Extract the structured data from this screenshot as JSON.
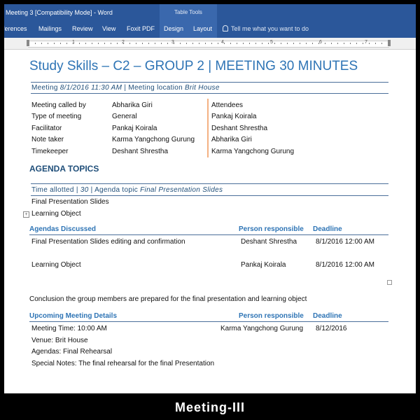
{
  "window": {
    "title": "Meeting 3 [Compatibility Mode] - Word",
    "context_tab_group": "Table Tools"
  },
  "ribbon": {
    "tabs": [
      "References",
      "Mailings",
      "Review",
      "View",
      "Foxit PDF",
      "Design",
      "Layout"
    ],
    "tabs_visible": [
      "ferences",
      "Mailings",
      "Review",
      "View",
      "Foxit PDF",
      "Design",
      "Layout"
    ],
    "tell_me": "Tell me what you want to do"
  },
  "ruler": {
    "numbers": [
      "1",
      "2",
      "3",
      "4",
      "5",
      "6",
      "7"
    ]
  },
  "doc": {
    "title": "Study Skills – C2 – GROUP 2  | MEETING 30 MINUTES",
    "meeting_line": {
      "prefix": "Meeting ",
      "date": "8/1/2016 11:30 AM",
      "sep": " | Meeting location ",
      "location": "Brit House"
    },
    "info": [
      {
        "label": "Meeting called by",
        "value": "Abharika Giri"
      },
      {
        "label": "Type of meeting",
        "value": "General"
      },
      {
        "label": "Facilitator",
        "value": "Pankaj Koirala"
      },
      {
        "label": "Note taker",
        "value": "Karma Yangchong Gurung"
      },
      {
        "label": "Timekeeper",
        "value": "Deshant Shrestha"
      }
    ],
    "attendees": [
      "Attendees",
      "Pankaj Koirala",
      "Deshant Shrestha",
      "Abharika Giri",
      "Karma Yangchong Gurung"
    ],
    "agenda_heading": "AGENDA TOPICS",
    "time_line": {
      "prefix": "Time allotted | ",
      "minutes": "30",
      "sep": " | Agenda topic ",
      "topic": "Final Presentation Slides"
    },
    "topic_line1": "Final Presentation Slides",
    "topic_line2": "Learning Object",
    "discussed": {
      "headers": [
        "Agendas Discussed",
        "Person responsible",
        "Deadline"
      ],
      "rows": [
        {
          "item": "Final Presentation Slides editing and confirmation",
          "person": "Deshant Shrestha",
          "deadline": "8/1/2016 12:00 AM"
        },
        {
          "item": "Learning Object",
          "person": "Pankaj Koirala",
          "deadline": "8/1/2016 12:00 AM"
        }
      ]
    },
    "conclusion": "Conclusion the group members are prepared for the final presentation and learning object",
    "upcoming": {
      "headers": [
        "Upcoming Meeting Details",
        "Person responsible",
        "Deadline"
      ],
      "time": "Meeting Time: 10:00 AM",
      "person": "Karma Yangchong Gurung",
      "deadline": "8/12/2016",
      "venue": "Venue: Brit House",
      "agendas": "Agendas: Final Rehearsal",
      "notes": "Special Notes: The final rehearsal for the final Presentation"
    }
  },
  "caption": "Meeting-III"
}
